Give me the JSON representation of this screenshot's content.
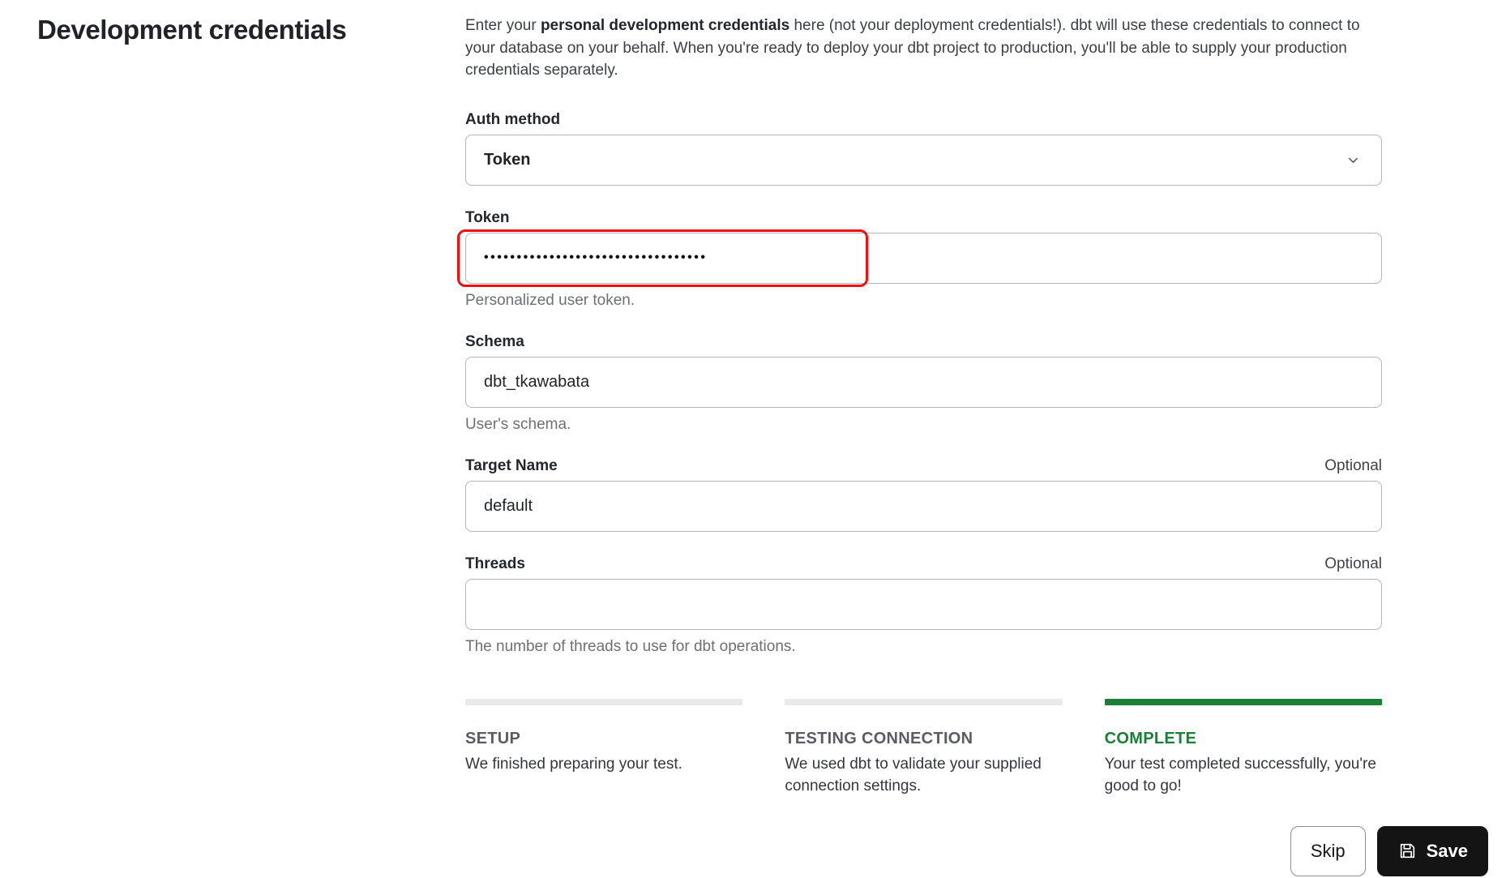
{
  "page": {
    "title": "Development credentials",
    "description": {
      "prefix": "Enter your ",
      "bold": "personal development credentials",
      "suffix": " here (not your deployment credentials!). dbt will use these credentials to connect to your database on your behalf. When you're ready to deploy your dbt project to production, you'll be able to supply your production credentials separately."
    }
  },
  "form": {
    "auth_method": {
      "label": "Auth method",
      "selected_value": "Token",
      "chevron_icon": "chevron-down-icon"
    },
    "token": {
      "label": "Token",
      "masked_value": "••••••••••••••••••••••••••••••••••",
      "helper": "Personalized user token.",
      "annotation": "red-highlight-box"
    },
    "schema": {
      "label": "Schema",
      "value": "dbt_tkawabata",
      "helper": "User's schema."
    },
    "target_name": {
      "label": "Target Name",
      "optional_tag": "Optional",
      "value": "default"
    },
    "threads": {
      "label": "Threads",
      "optional_tag": "Optional",
      "value": "",
      "helper": "The number of threads to use for dbt operations."
    }
  },
  "steps": [
    {
      "title": "SETUP",
      "description": "We finished preparing your test.",
      "state": "done"
    },
    {
      "title": "TESTING CONNECTION",
      "description": "We used dbt to validate your supplied connection settings.",
      "state": "done"
    },
    {
      "title": "COMPLETE",
      "description": "Your test completed successfully, you're good to go!",
      "state": "complete"
    }
  ],
  "actions": {
    "skip_label": "Skip",
    "save_label": "Save",
    "save_icon": "floppy-disk-icon"
  },
  "colors": {
    "accent_green": "#1a8038",
    "annotation_red": "#ee1111",
    "step_bar_gray": "#e9e9e9",
    "save_button_bg": "#141414"
  }
}
